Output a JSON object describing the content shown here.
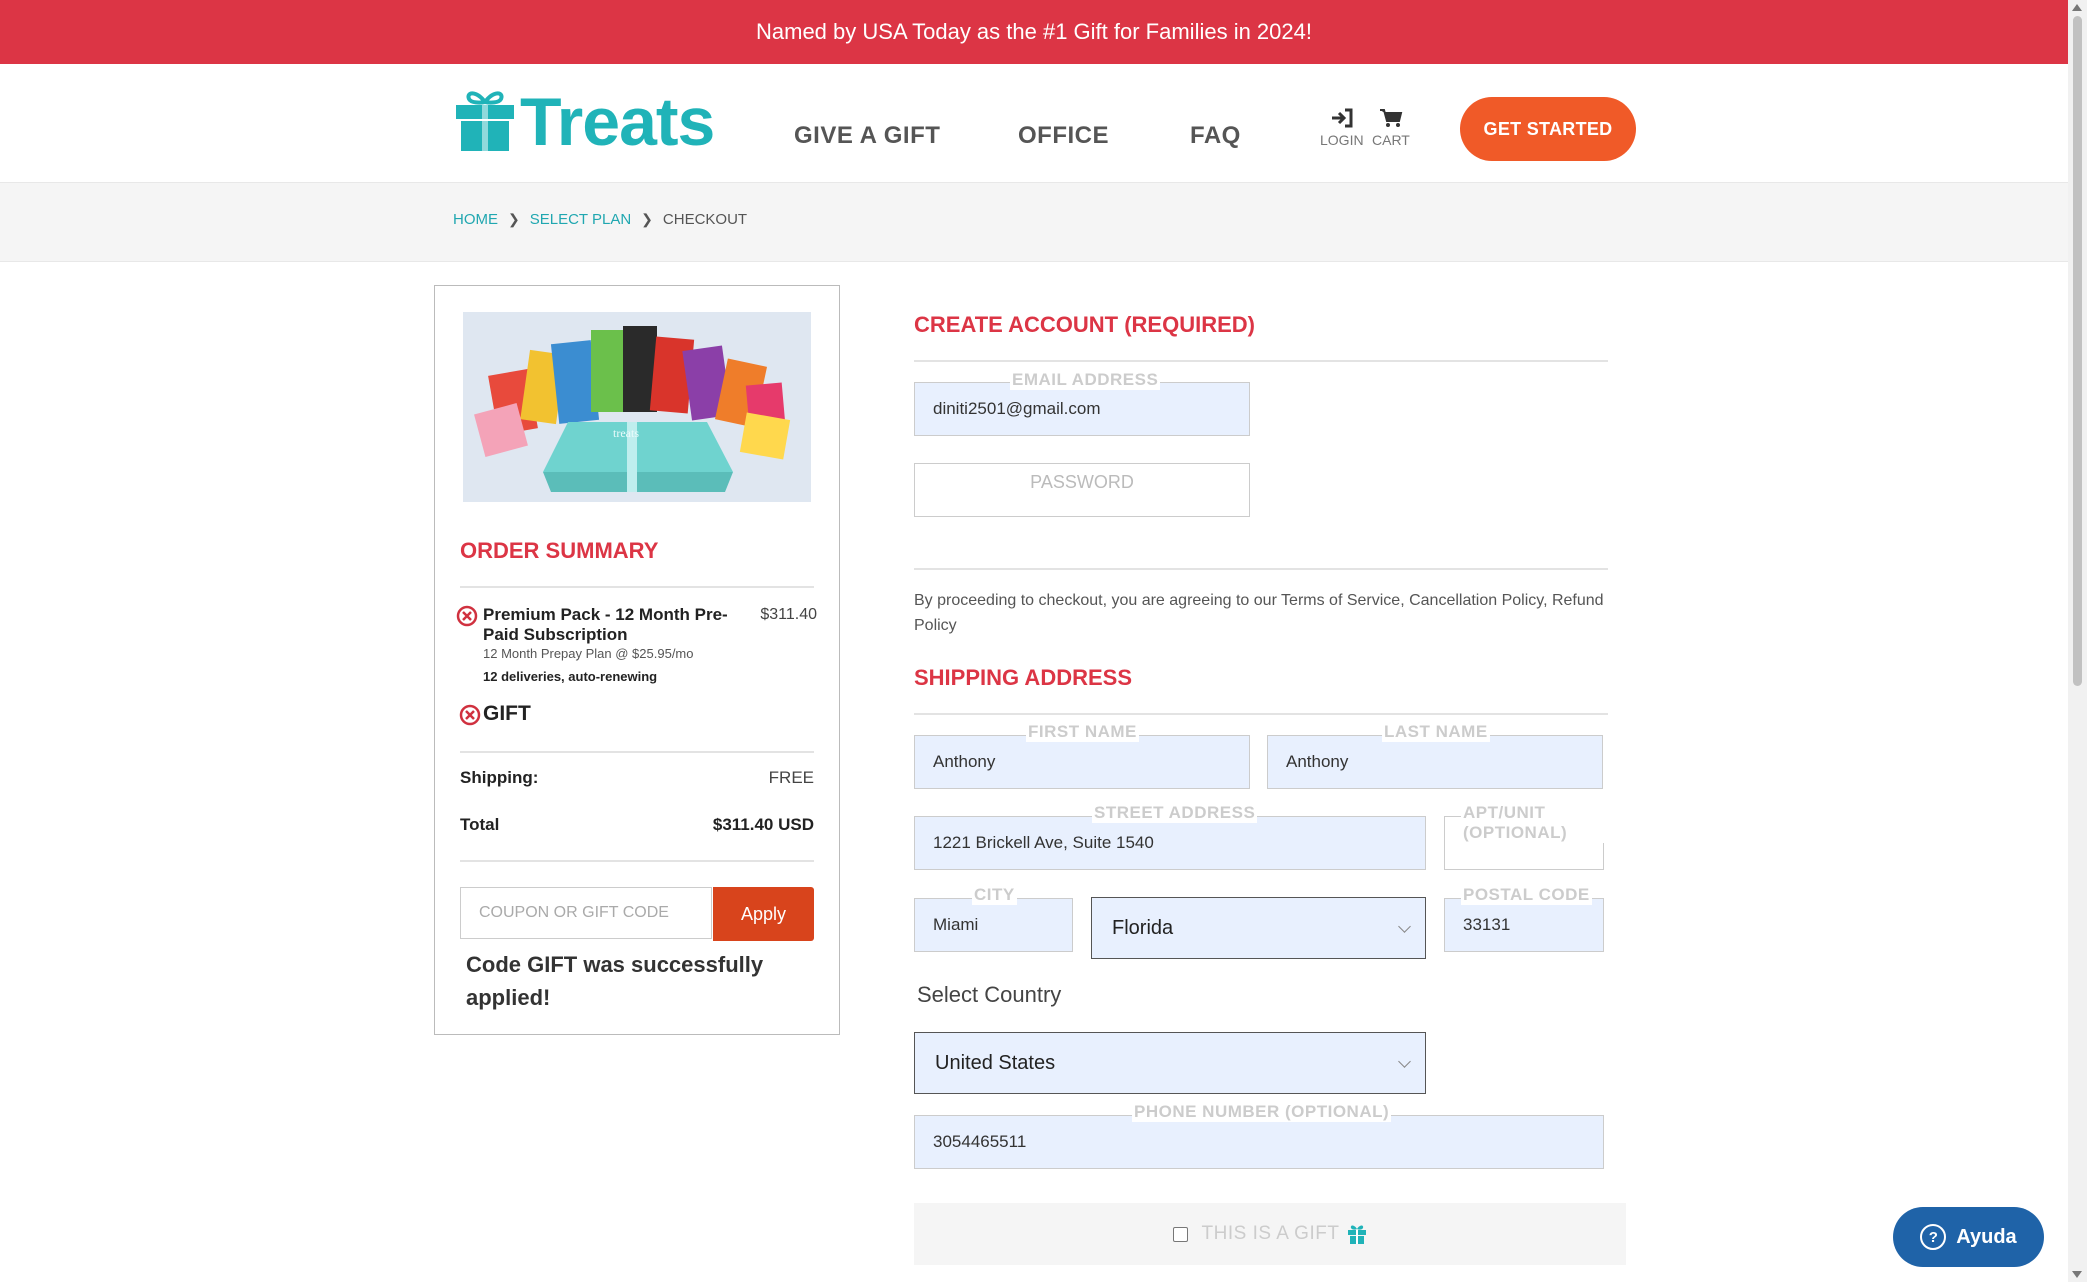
{
  "banner": {
    "text": "Named by USA Today as the #1 Gift for Families in 2024!"
  },
  "header": {
    "logo_text": "Treats",
    "nav": [
      "GIVE A GIFT",
      "OFFICE",
      "FAQ"
    ],
    "login_label": "LOGIN",
    "cart_label": "CART",
    "get_started": "GET STARTED"
  },
  "breadcrumb": {
    "home": "HOME",
    "plan": "SELECT PLAN",
    "current": "CHECKOUT"
  },
  "order_summary": {
    "title": "ORDER SUMMARY",
    "item": {
      "name": "Premium Pack - 12 Month Pre-Paid Subscription",
      "price": "$311.40",
      "subtitle": "12 Month Prepay Plan @ $25.95/mo",
      "deliveries": "12 deliveries, auto-renewing"
    },
    "gift_label": "GIFT",
    "shipping_label": "Shipping:",
    "shipping_value": "FREE",
    "total_label": "Total",
    "total_value": "$311.40 USD",
    "coupon_placeholder": "COUPON OR GIFT CODE",
    "apply_label": "Apply",
    "success_message": "Code GIFT was successfully applied!"
  },
  "account": {
    "title": "CREATE ACCOUNT (REQUIRED)",
    "email_label": "EMAIL ADDRESS",
    "email_value": "diniti2501@gmail.com",
    "password_placeholder": "PASSWORD",
    "terms": "By proceeding to checkout, you are agreeing to our Terms of Service, Cancellation Policy, Refund Policy"
  },
  "shipping": {
    "title": "SHIPPING ADDRESS",
    "first_name_label": "FIRST NAME",
    "first_name": "Anthony",
    "last_name_label": "LAST NAME",
    "last_name": "Anthony",
    "street_label": "STREET ADDRESS",
    "street": "1221 Brickell Ave, Suite 1540",
    "apt_label": "APT/UNIT (OPTIONAL)",
    "apt": "",
    "city_label": "CITY",
    "city": "Miami",
    "state": "Florida",
    "postal_label": "POSTAL CODE",
    "postal": "33131",
    "country_label": "Select Country",
    "country": "United States",
    "phone_label": "PHONE NUMBER (OPTIONAL)",
    "phone": "3054465511",
    "gift_checkbox_label": "THIS IS A GIFT"
  },
  "help": {
    "label": "Ayuda"
  },
  "colors": {
    "brand": "#20b3b8",
    "accent": "#dc3545",
    "cta": "#f05a28",
    "help": "#1f63a8"
  }
}
